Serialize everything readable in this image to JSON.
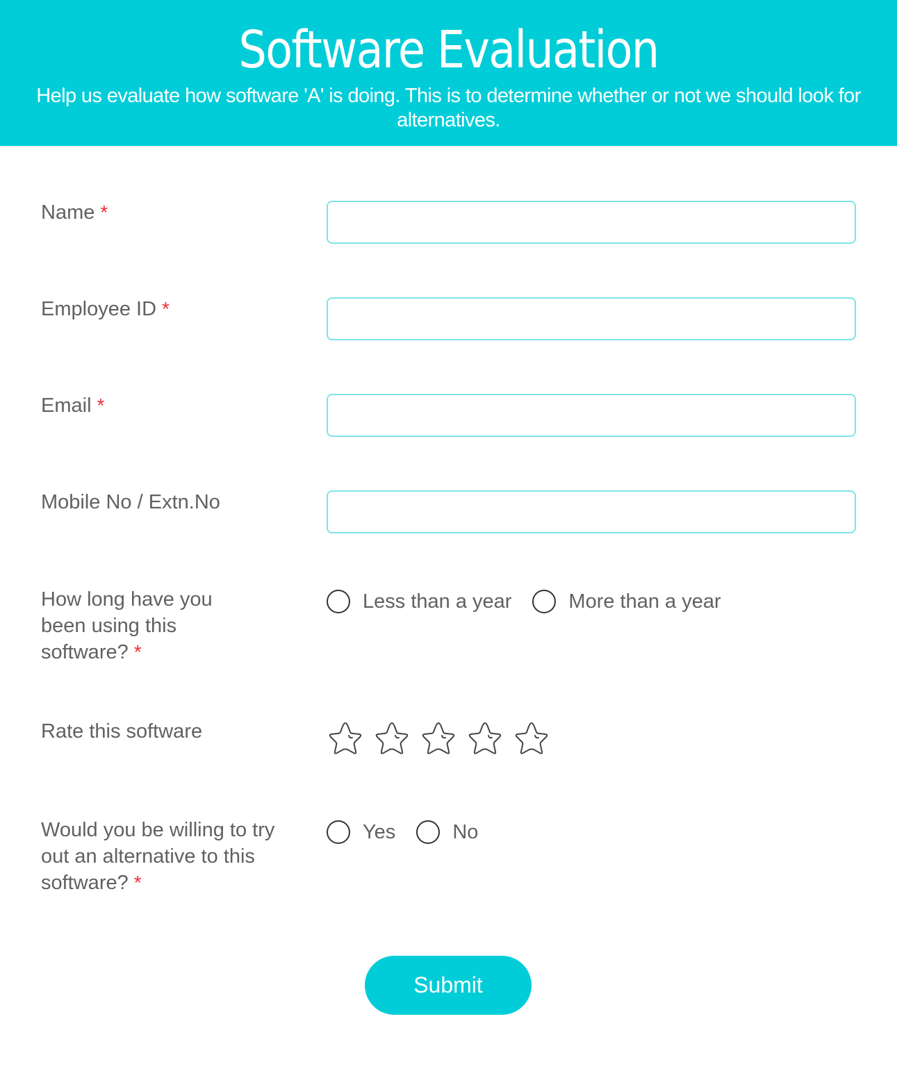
{
  "header": {
    "title": "Software Evaluation",
    "subtitle": "Help us evaluate how software 'A' is doing. This is to determine whether or not we should look for alternatives."
  },
  "colors": {
    "brand": "#00cdd8",
    "required": "#ef2b3a",
    "input_border": "#7fe3e6",
    "label_text": "#616161"
  },
  "form": {
    "required_marker": "*",
    "fields": {
      "name": {
        "label": "Name",
        "required": true,
        "value": "",
        "placeholder": ""
      },
      "employee_id": {
        "label": "Employee ID",
        "required": true,
        "value": "",
        "placeholder": ""
      },
      "email": {
        "label": "Email",
        "required": true,
        "value": "",
        "placeholder": ""
      },
      "mobile": {
        "label": "Mobile No / Extn.No",
        "required": false,
        "value": "",
        "placeholder": ""
      }
    },
    "usage_duration": {
      "label": "How long have you been using this software?",
      "required": true,
      "options": [
        "Less than a year",
        "More than a year"
      ],
      "selected": null
    },
    "rating": {
      "label": "Rate this software",
      "max_stars": 5,
      "value": 0,
      "icon": "star-outline-icon"
    },
    "try_alternative": {
      "label": "Would you be willing to try out an alternative to this software?",
      "required": true,
      "options": [
        "Yes",
        "No"
      ],
      "selected": null
    },
    "submit_label": "Submit"
  }
}
